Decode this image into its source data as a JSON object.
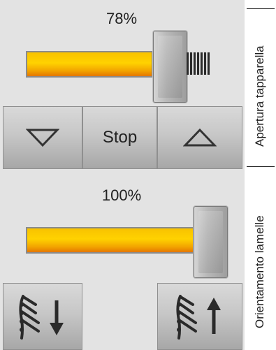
{
  "blind_opening": {
    "label": "Apertura tapparella",
    "value_text": "78%",
    "level": 0.78,
    "buttons": {
      "down_icon": "triangle-down-icon",
      "stop_label": "Stop",
      "up_icon": "triangle-up-icon"
    }
  },
  "slat_orientation": {
    "label": "Orientamento lamelle",
    "value_text": "100%",
    "level": 1.0,
    "buttons": {
      "tilt_down_icon": "slats-arrow-down-icon",
      "tilt_up_icon": "slats-arrow-up-icon"
    }
  },
  "colors": {
    "bar_top": "#ffd200",
    "bar_bottom": "#e06a00",
    "button": "#c7c7c7",
    "background": "#e3e3e3"
  }
}
